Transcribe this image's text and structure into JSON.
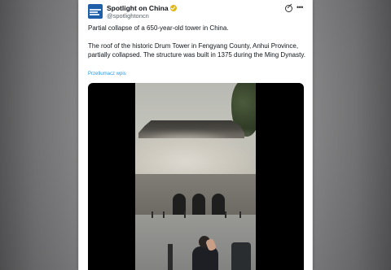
{
  "tweet": {
    "author_name": "Spotlight on China",
    "author_handle": "@spotlightoncn",
    "avatar_label": "Spotlight on China avatar",
    "line1": "Partial collapse of a 650-year-old tower in China.",
    "line2": "The roof of the historic Drum Tower in Fengyang County, Anhui Province, partially collapsed. The structure was built in 1375 during the Ming Dynasty.",
    "translate_label": "Przetłumacz wpis"
  },
  "icons": {
    "verified": "verified-badge-icon",
    "grok": "grok-icon",
    "more": "more-options-icon"
  },
  "colors": {
    "verified_gold": "#e2b719",
    "link_blue": "#1d9bf0",
    "avatar_blue": "#1f5fa8"
  }
}
